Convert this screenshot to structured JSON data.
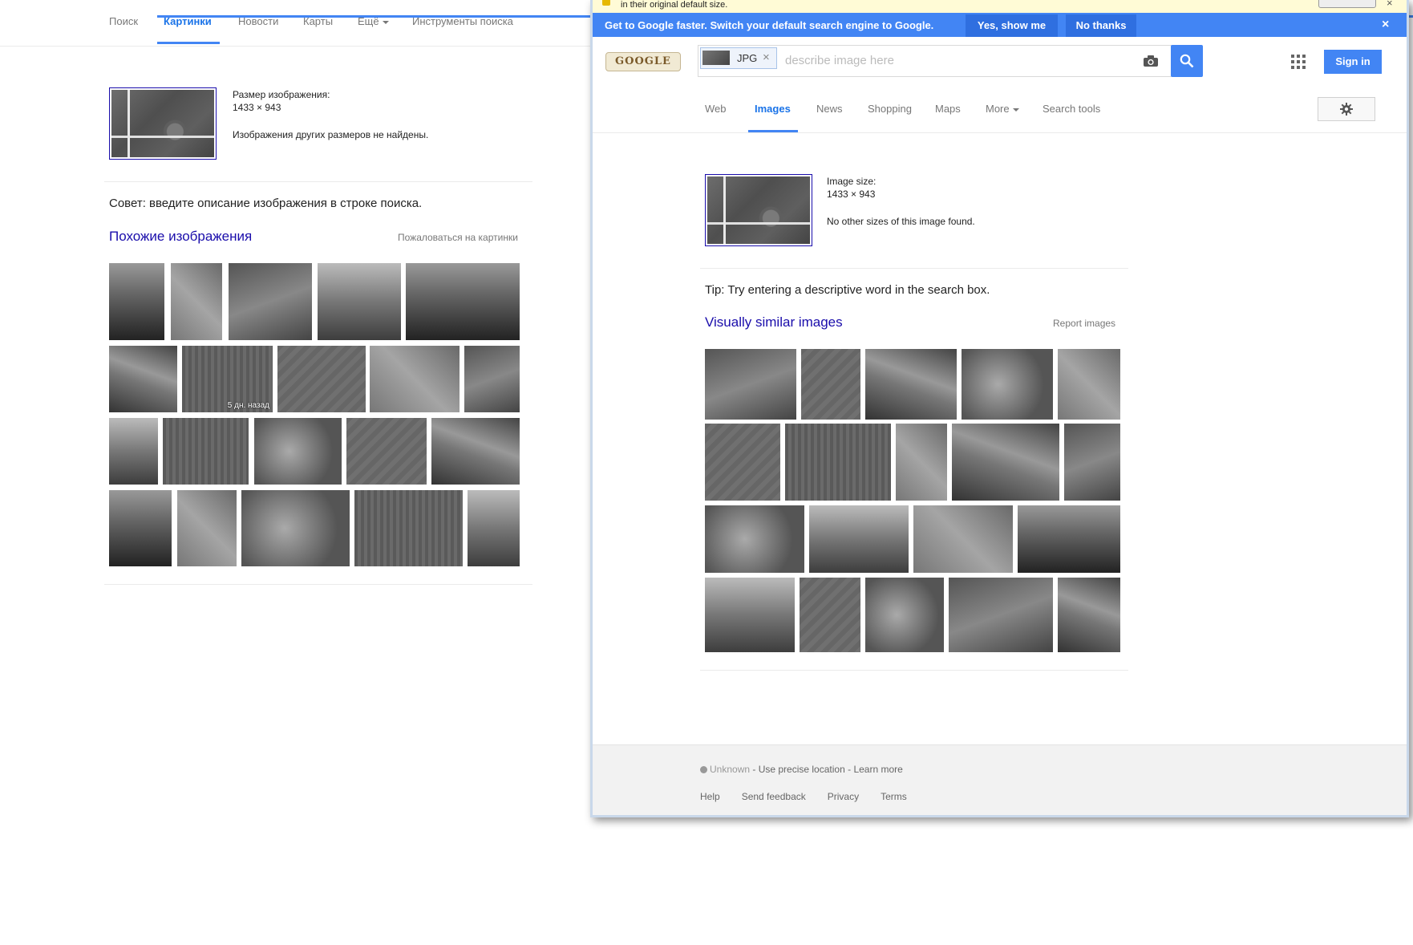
{
  "left": {
    "tabs": [
      "Поиск",
      "Картинки",
      "Новости",
      "Карты",
      "Ещё",
      "Инструменты поиска"
    ],
    "image_size_label": "Размер изображения:",
    "image_size_value": "1433 × 943",
    "no_other_sizes": "Изображения других размеров не найдены.",
    "tip": "Совет: введите описание изображения в строке поиска.",
    "similar_title": "Похожие изображения",
    "report": "Пожаловаться на картинки",
    "thumb_stamp": "5 дн. назад"
  },
  "window": {
    "warning_text": "in their original default size.",
    "banner_text": "Get to Google faster. Switch your default search engine to Google.",
    "banner_yes": "Yes, show me",
    "banner_no": "No thanks",
    "banner_close": "×",
    "logo_text": "GOOGLE",
    "chip_label": "JPG",
    "chip_remove": "×",
    "search_placeholder": "describe image here",
    "signin": "Sign in",
    "tabs": [
      "Web",
      "Images",
      "News",
      "Shopping",
      "Maps",
      "More",
      "Search tools"
    ],
    "image_size_label": "Image size:",
    "image_size_value": "1433 × 943",
    "no_other_sizes": "No other sizes of this image found.",
    "tip": "Tip: Try entering a descriptive word in the search box.",
    "similar_title": "Visually similar images",
    "report": "Report images",
    "footer": {
      "location_status": "Unknown",
      "sep1": " - ",
      "precise": "Use precise location",
      "sep2": " - ",
      "learn_more": "Learn more",
      "links": [
        "Help",
        "Send feedback",
        "Privacy",
        "Terms"
      ]
    }
  },
  "colors": {
    "accent": "#4285f4",
    "link": "#1a0dab",
    "active_tab": "#1a73e8",
    "banner": "#4285f4"
  },
  "icons": {
    "camera": "camera-icon",
    "search": "search-icon",
    "apps": "apps-grid-icon",
    "settings": "gear-icon",
    "close": "close-icon"
  }
}
